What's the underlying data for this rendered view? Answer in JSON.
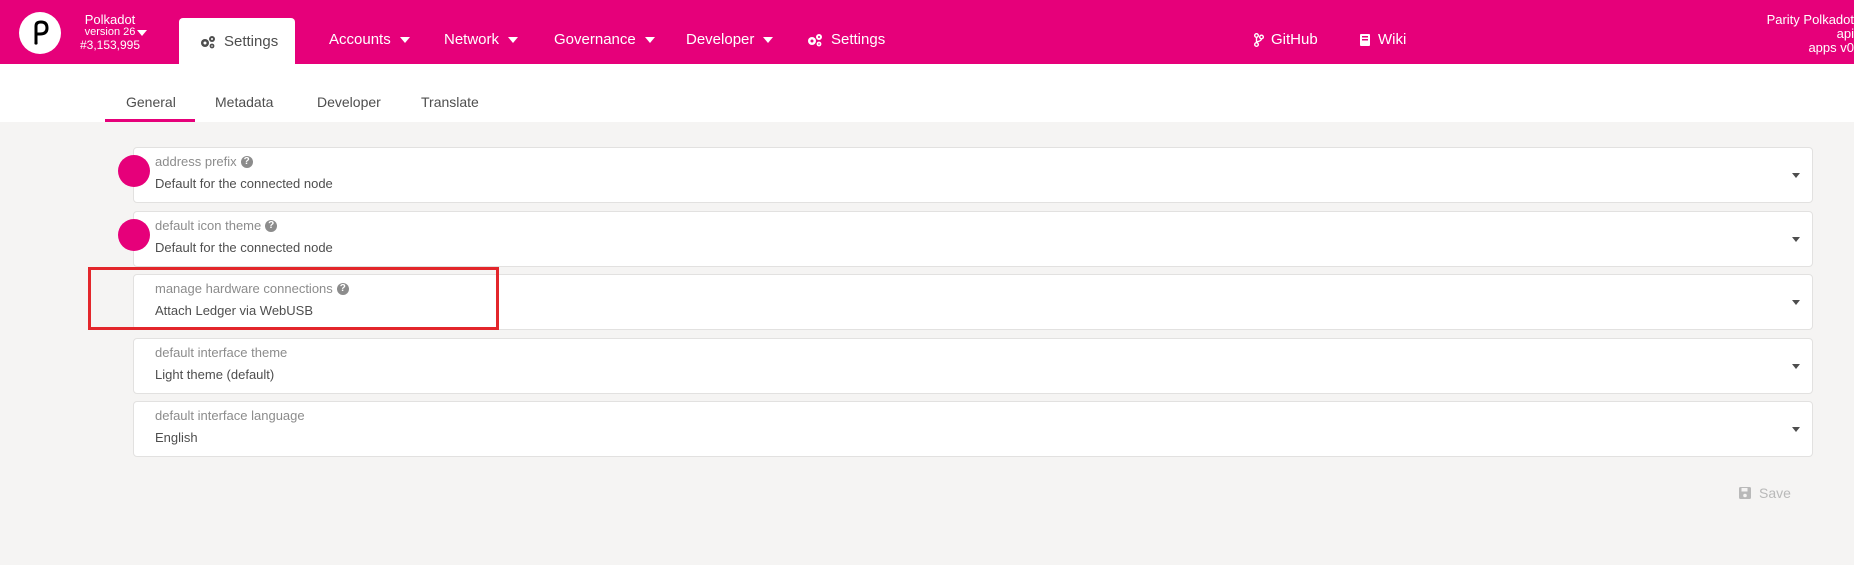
{
  "header": {
    "chain_name": "Polkadot",
    "chain_version": "version 26",
    "chain_block": "#3,153,995",
    "active_tab_label": "Settings",
    "nav": [
      {
        "label": "Accounts"
      },
      {
        "label": "Network"
      },
      {
        "label": "Governance"
      },
      {
        "label": "Developer"
      },
      {
        "label": "Settings"
      }
    ],
    "github_label": "GitHub",
    "wiki_label": "Wiki",
    "right_lines": [
      "Parity Polkadot",
      "api",
      "apps v0"
    ]
  },
  "subnav": {
    "tabs": [
      {
        "label": "General"
      },
      {
        "label": "Metadata"
      },
      {
        "label": "Developer"
      },
      {
        "label": "Translate"
      }
    ]
  },
  "settings": {
    "rows": [
      {
        "label": "address prefix",
        "value": "Default for the connected node"
      },
      {
        "label": "default icon theme",
        "value": "Default for the connected node"
      },
      {
        "label": "manage hardware connections",
        "value": "Attach Ledger via WebUSB"
      },
      {
        "label": "default interface theme",
        "value": "Light theme (default)"
      },
      {
        "label": "default interface language",
        "value": "English"
      }
    ],
    "save_label": "Save"
  },
  "colors": {
    "brand": "#e6007a",
    "highlight": "#e3262b"
  },
  "icons": {
    "help": "?"
  }
}
